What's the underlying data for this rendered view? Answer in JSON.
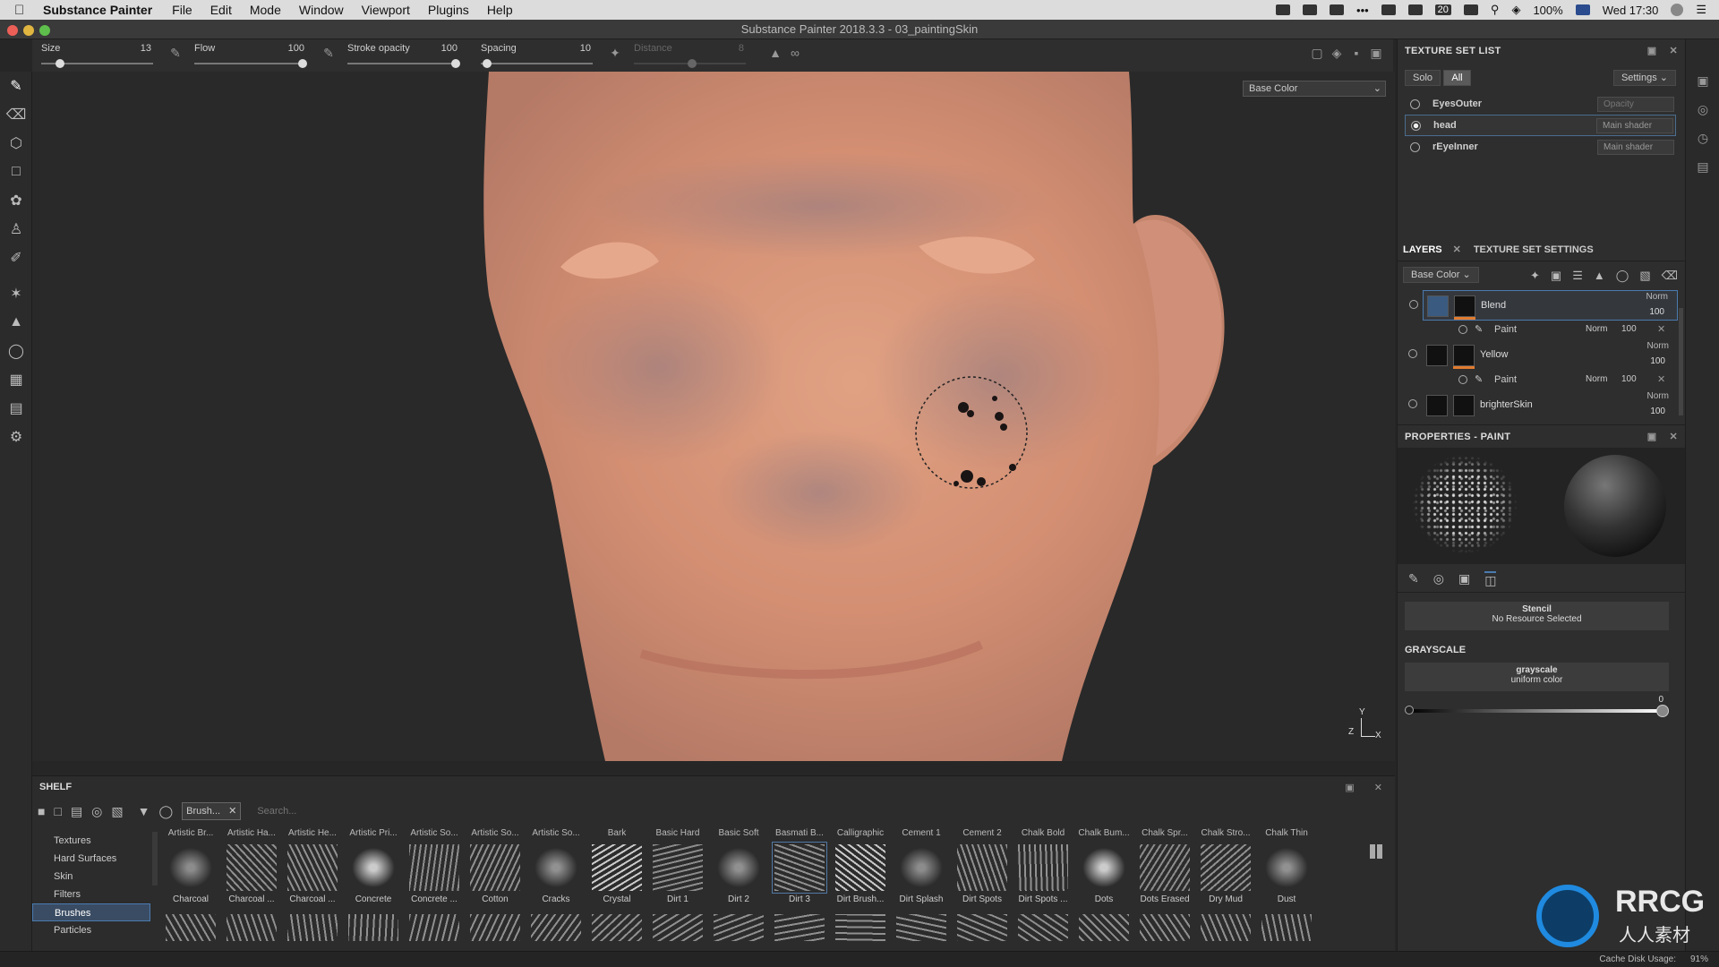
{
  "menubar": {
    "app": "Substance Painter",
    "items": [
      "File",
      "Edit",
      "Mode",
      "Window",
      "Viewport",
      "Plugins",
      "Help"
    ],
    "calendar_day": "20",
    "battery": "100%",
    "clock": "Wed 17:30"
  },
  "window": {
    "title": "Substance Painter 2018.3.3 - 03_paintingSkin"
  },
  "toolbar": {
    "params": [
      {
        "label": "Size",
        "value": "13",
        "level": 0.2
      },
      {
        "label": "Flow",
        "value": "100",
        "level": 1.0
      },
      {
        "label": "Stroke opacity",
        "value": "100",
        "level": 1.0
      },
      {
        "label": "Spacing",
        "value": "10",
        "level": 0.08
      },
      {
        "label": "Distance",
        "value": "8",
        "level": 0.45
      }
    ]
  },
  "viewport": {
    "channel": "Base Color",
    "axis_y": "Y",
    "axis_z": "Z",
    "axis_x": "X"
  },
  "texture_set_list": {
    "title": "TEXTURE SET LIST",
    "solo": "Solo",
    "all": "All",
    "settings": "Settings",
    "sets": [
      {
        "name": "EyesOuter",
        "shader": "Opacity",
        "selected": false
      },
      {
        "name": "head",
        "shader": "Main shader",
        "selected": true
      },
      {
        "name": "rEyeInner",
        "shader": "Main shader",
        "selected": false
      }
    ]
  },
  "layers": {
    "tab_layers": "LAYERS",
    "tab_settings": "TEXTURE SET SETTINGS",
    "channel": "Base Color",
    "items": [
      {
        "name": "Blend",
        "blend": "Norm",
        "opacity": "100",
        "sub": {
          "name": "Paint",
          "blend": "Norm",
          "opacity": "100"
        }
      },
      {
        "name": "Yellow",
        "blend": "Norm",
        "opacity": "100",
        "sub": {
          "name": "Paint",
          "blend": "Norm",
          "opacity": "100"
        }
      },
      {
        "name": "brighterSkin",
        "blend": "Norm",
        "opacity": "100"
      }
    ]
  },
  "properties": {
    "title": "PROPERTIES - PAINT",
    "stencil_title": "Stencil",
    "stencil_value": "No Resource Selected",
    "grayscale_title": "GRAYSCALE",
    "grayscale_name": "grayscale",
    "grayscale_sub": "uniform color",
    "grayscale_value": "0",
    "grayscale_level": 1.0
  },
  "shelf": {
    "title": "SHELF",
    "filter_tag": "Brush...",
    "search_placeholder": "Search...",
    "categories": [
      "Textures",
      "Hard Surfaces",
      "Skin",
      "Filters",
      "Brushes",
      "Particles"
    ],
    "active_category": "Brushes",
    "brushes": [
      {
        "top": "Artistic Br...",
        "label": "Charcoal"
      },
      {
        "top": "Artistic Ha...",
        "label": "Charcoal ..."
      },
      {
        "top": "Artistic He...",
        "label": "Charcoal ..."
      },
      {
        "top": "Artistic Pri...",
        "label": "Concrete"
      },
      {
        "top": "Artistic So...",
        "label": "Concrete ..."
      },
      {
        "top": "Artistic So...",
        "label": "Cotton"
      },
      {
        "top": "Artistic So...",
        "label": "Cracks"
      },
      {
        "top": "Bark",
        "label": "Crystal"
      },
      {
        "top": "Basic Hard",
        "label": "Dirt 1"
      },
      {
        "top": "Basic Soft",
        "label": "Dirt 2"
      },
      {
        "top": "Basmati B...",
        "label": "Dirt 3",
        "selected": true
      },
      {
        "top": "Calligraphic",
        "label": "Dirt Brush..."
      },
      {
        "top": "Cement 1",
        "label": "Dirt Splash"
      },
      {
        "top": "Cement 2",
        "label": "Dirt Spots"
      },
      {
        "top": "Chalk Bold",
        "label": "Dirt Spots ..."
      },
      {
        "top": "Chalk Bum...",
        "label": "Dots"
      },
      {
        "top": "Chalk Spr...",
        "label": "Dots Erased"
      },
      {
        "top": "Chalk Stro...",
        "label": "Dry Mud"
      },
      {
        "top": "Chalk Thin",
        "label": "Dust"
      }
    ]
  },
  "status": {
    "cache_label": "Cache Disk Usage:",
    "cache_value": "91%"
  },
  "watermark": {
    "text": "RRCG",
    "sub": "人人素材"
  },
  "colors": {
    "accent": "#4a7bb0",
    "skin": "#d9967a",
    "orange": "#e07b30"
  }
}
